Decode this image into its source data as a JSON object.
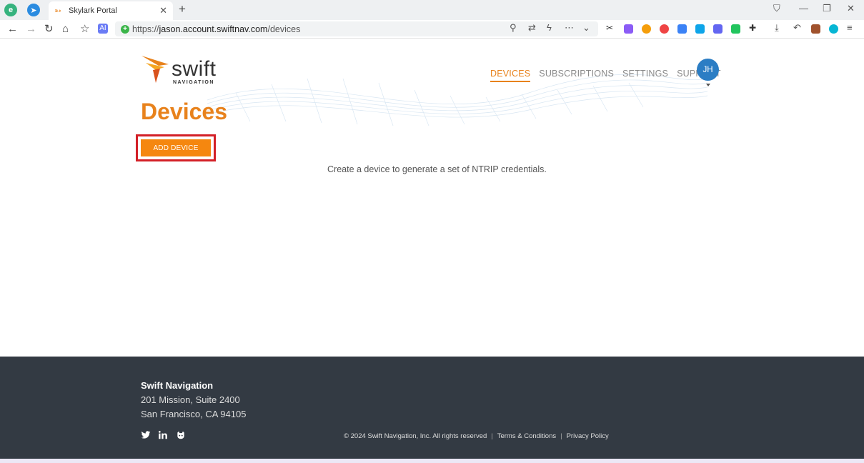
{
  "browser": {
    "tab_title": "Skylark Portal",
    "url_scheme": "https://",
    "url_host": "jason.account.swiftnav.com",
    "url_path": "/devices"
  },
  "header": {
    "logo_word": "swift",
    "logo_sub": "NAVIGATION",
    "nav": [
      "DEVICES",
      "SUBSCRIPTIONS",
      "SETTINGS",
      "SUPPORT"
    ],
    "active_nav": "DEVICES",
    "avatar_initials": "JH"
  },
  "main": {
    "title": "Devices",
    "add_button": "ADD DEVICE",
    "empty_message": "Create a device to generate a set of NTRIP credentials."
  },
  "footer": {
    "company": "Swift Navigation",
    "address_line1": "201 Mission, Suite 2400",
    "address_line2": "San Francisco, CA 94105",
    "social_icons": [
      "twitter-icon",
      "linkedin-icon",
      "github-icon"
    ],
    "copyright": "© 2024 Swift Navigation, Inc. All rights reserved",
    "separator": "|",
    "terms": "Terms & Conditions",
    "privacy": "Privacy Policy"
  },
  "colors": {
    "accent": "#e8821c",
    "button": "#f5870f",
    "highlight": "#d32027",
    "avatar": "#2b7dc4",
    "footer_bg": "#333a43"
  }
}
